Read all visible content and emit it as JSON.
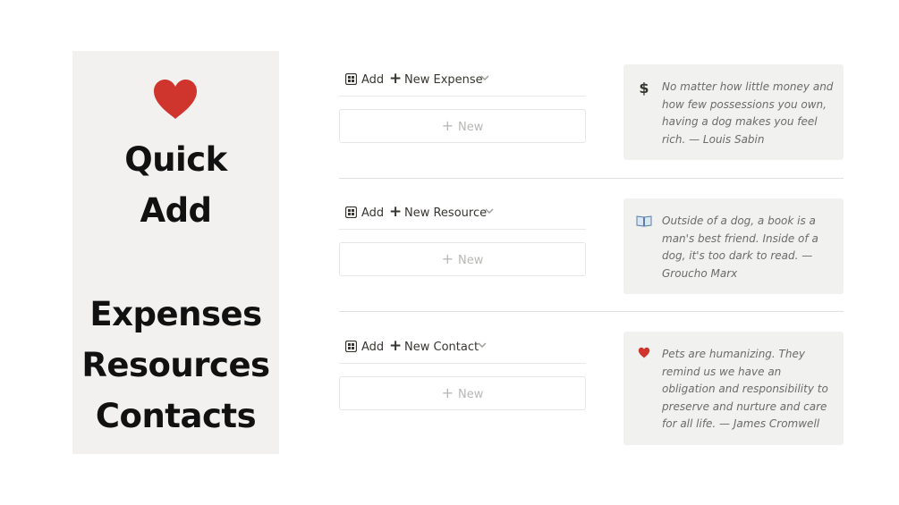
{
  "sidebar": {
    "heart_icon": "red-heart-icon",
    "title_line1": "Quick",
    "title_line2": "Add",
    "items": [
      "Expenses",
      "Resources",
      "Contacts"
    ]
  },
  "sections": [
    {
      "add_label": "Add",
      "new_label": "New Expense",
      "new_button_label": "New",
      "quote_icon": "dollar-icon",
      "quote": "No matter how little money and how few possessions you own, having a dog makes you feel rich.  — Louis Sabin"
    },
    {
      "add_label": "Add",
      "new_label": "New Resource",
      "new_button_label": "New",
      "quote_icon": "book-icon",
      "quote": "Outside of a dog, a book is a man's best friend. Inside of a dog, it's too dark to read.  — Groucho Marx"
    },
    {
      "add_label": "Add",
      "new_label": "New Contact",
      "new_button_label": "New",
      "quote_icon": "heart-icon",
      "quote": "Pets are humanizing. They remind us we have an obligation and responsibility to preserve and nurture and care for all life. — James Cromwell"
    }
  ],
  "colors": {
    "heart": "#d0352d",
    "sidebar_bg": "#f2f1ef",
    "quote_bg": "#f1f1ef"
  }
}
